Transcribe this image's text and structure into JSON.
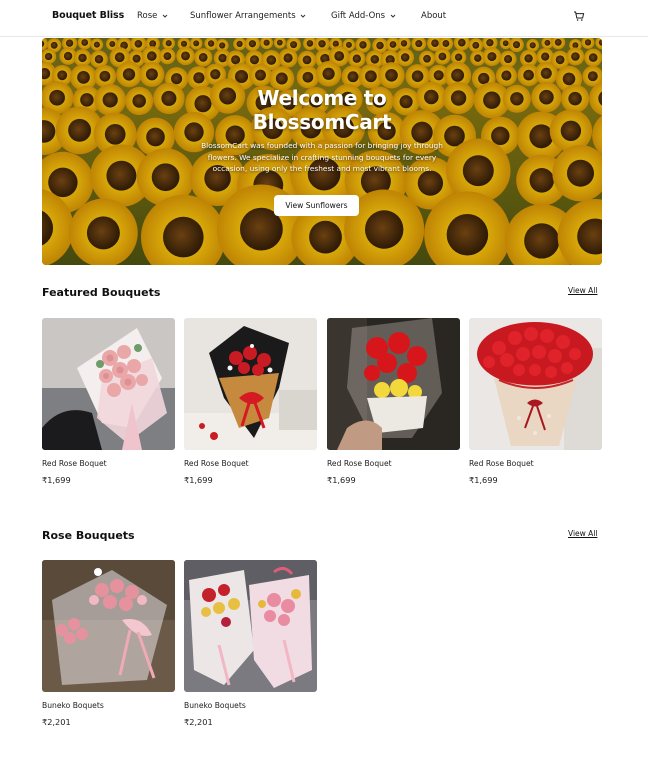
{
  "nav": {
    "brand": "Bouquet Bliss",
    "items": [
      {
        "label": "Rose",
        "dropdown": true
      },
      {
        "label": "Sunflower Arrangements",
        "dropdown": true
      },
      {
        "label": "Gift Add-Ons",
        "dropdown": true
      },
      {
        "label": "About",
        "dropdown": false
      }
    ],
    "cart_icon": "cart-icon"
  },
  "hero": {
    "title_line1": "Welcome to",
    "title_line2": "BlossomCart",
    "description": "BlossomCart was founded with a passion for bringing joy through flowers. We specialize in crafting stunning bouquets for every occasion, using only the freshest and most vibrant blooms.",
    "button_label": "View Sunflowers",
    "image": "sunflower-field"
  },
  "featured": {
    "title": "Featured Bouquets",
    "view_all": "View All",
    "products": [
      {
        "name": "Red Rose Boquet",
        "price": "₹1,699",
        "image": "pink-crochet-roses"
      },
      {
        "name": "Red Rose Boquet",
        "price": "₹1,699",
        "image": "black-wrap-red-roses"
      },
      {
        "name": "Red Rose Boquet",
        "price": "₹1,699",
        "image": "clear-wrap-red-roses-lights"
      },
      {
        "name": "Red Rose Boquet",
        "price": "₹1,699",
        "image": "lace-wrap-red-rose-dome"
      }
    ]
  },
  "rose": {
    "title": "Rose Bouquets",
    "view_all": "View All",
    "products": [
      {
        "name": "Buneko Boquets",
        "price": "₹2,201",
        "image": "pink-roses-pink-ribbon"
      },
      {
        "name": "Buneko Boquets",
        "price": "₹2,201",
        "image": "two-mixed-bouquets"
      }
    ]
  },
  "colors": {
    "accent": "#111111",
    "background": "#ffffff",
    "sunflower_yellow": "#f2b705"
  }
}
